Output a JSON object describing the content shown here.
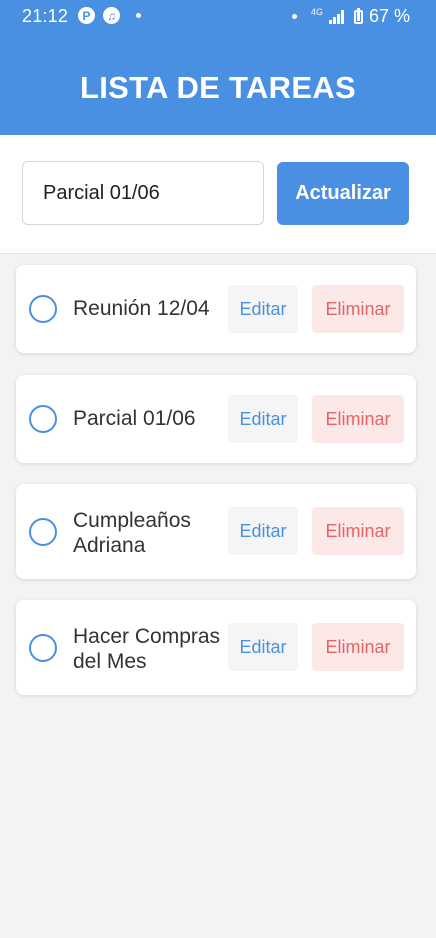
{
  "status_bar": {
    "time": "21:12",
    "left_icons": [
      "p-app-icon",
      "music-app-icon"
    ],
    "network_label": "4G",
    "battery": "67 %"
  },
  "header": {
    "title": "LISTA DE TAREAS",
    "color": "#4a90e2"
  },
  "editor": {
    "input_value": "Parcial 01/06",
    "update_label": "Actualizar"
  },
  "tasks": [
    {
      "text": "Reunión 12/04",
      "edit_label": "Editar",
      "delete_label": "Eliminar"
    },
    {
      "text": "Parcial 01/06",
      "edit_label": "Editar",
      "delete_label": "Eliminar"
    },
    {
      "text": "Cumpleaños Adriana",
      "edit_label": "Editar",
      "delete_label": "Eliminar"
    },
    {
      "text": "Hacer Compras del Mes",
      "edit_label": "Editar",
      "delete_label": "Eliminar"
    }
  ],
  "colors": {
    "accent": "#4a90e2",
    "delete_text": "#e06666",
    "delete_bg": "#fde8e8",
    "background": "#f3f3f3"
  }
}
